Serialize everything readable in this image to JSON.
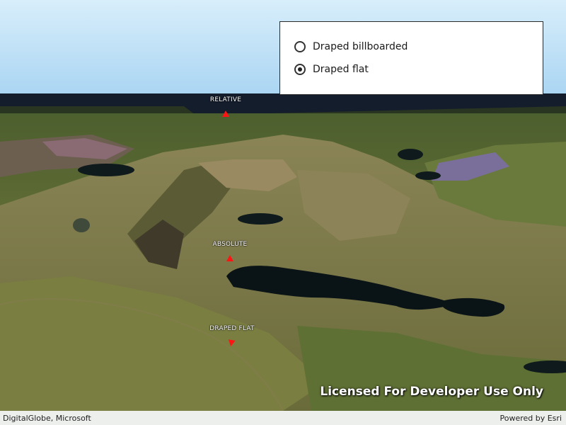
{
  "scene": {
    "markers": [
      {
        "label": "RELATIVE",
        "symbol": "triangle",
        "color": "#ff1414"
      },
      {
        "label": "ABSOLUTE",
        "symbol": "triangle",
        "color": "#ff1414"
      },
      {
        "label": "DRAPED FLAT",
        "symbol": "triangle",
        "color": "#ff1414"
      }
    ]
  },
  "panel": {
    "options": [
      {
        "label": "Draped billboarded",
        "checked": false
      },
      {
        "label": "Draped flat",
        "checked": true
      }
    ]
  },
  "watermark": "Licensed For Developer Use Only",
  "attribution": {
    "left": "DigitalGlobe, Microsoft",
    "right": "Powered by Esri"
  }
}
